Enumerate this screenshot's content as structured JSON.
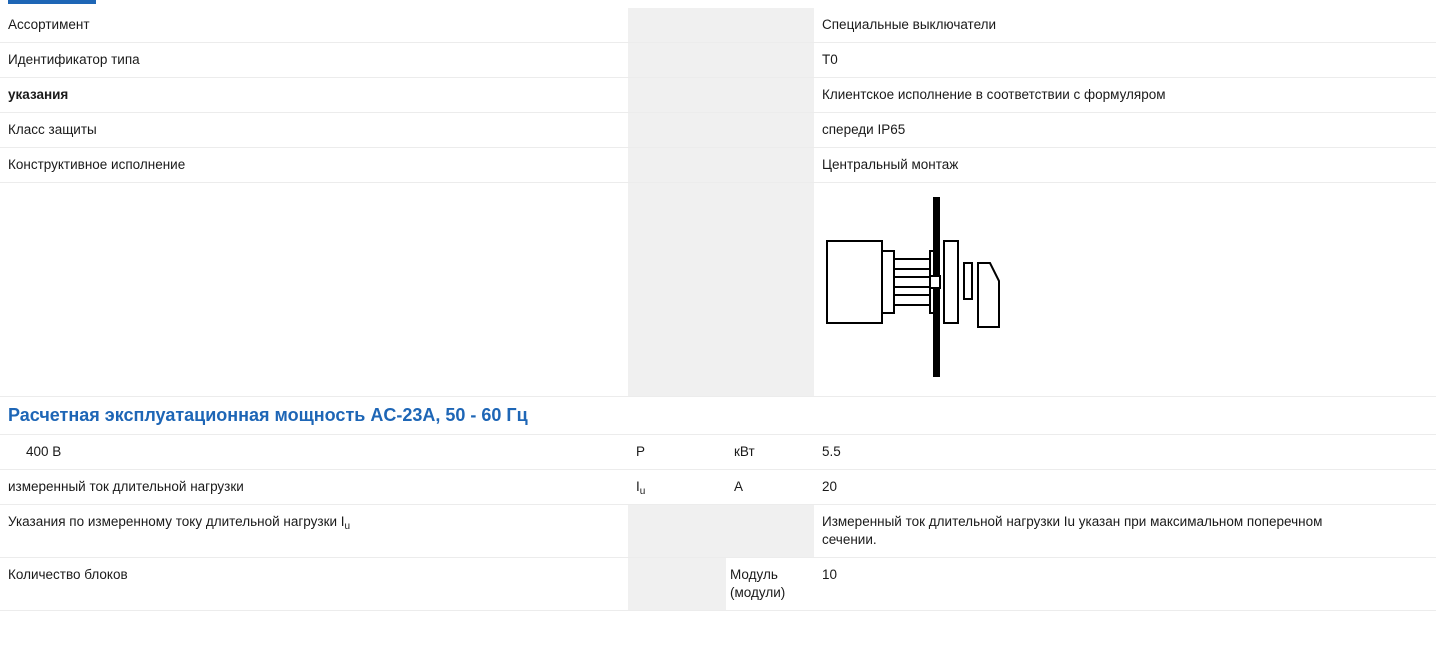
{
  "rows_top": [
    {
      "label": "Ассортимент",
      "sym": "",
      "unit": "",
      "value": "Специальные выключатели",
      "bold": false
    },
    {
      "label": "Идентификатор типа",
      "sym": "",
      "unit": "",
      "value": "T0",
      "bold": false
    },
    {
      "label": "указания",
      "sym": "",
      "unit": "",
      "value": "Клиентское исполнение в соответствии с формуляром",
      "bold": true
    },
    {
      "label": "Класс защиты",
      "sym": "",
      "unit": "",
      "value": "спереди IP65",
      "bold": false
    },
    {
      "label": "Конструктивное исполнение",
      "sym": "",
      "unit": "",
      "value": "Центральный монтаж",
      "bold": false
    }
  ],
  "diagram": {
    "name": "central-mounting-diagram"
  },
  "section": {
    "title": "Расчетная эксплуатационная мощность AC-23A, 50 - 60 Гц"
  },
  "rows_bottom": {
    "voltage": {
      "label": "400 В",
      "sym": "P",
      "unit": "кВт",
      "value": "5.5"
    },
    "current": {
      "label": "измеренный ток длительной нагрузки",
      "sym_main": "I",
      "sym_sub": "u",
      "unit": "A",
      "value": "20"
    },
    "note": {
      "label_main": "Указания по измеренному току длительной нагрузки I",
      "label_sub": "u",
      "value": "Измеренный ток длительной нагрузки Iu указан при максимальном поперечном сечении."
    },
    "blocks": {
      "label": "Количество блоков",
      "unit": "Модуль (модули)",
      "value": "10"
    }
  }
}
